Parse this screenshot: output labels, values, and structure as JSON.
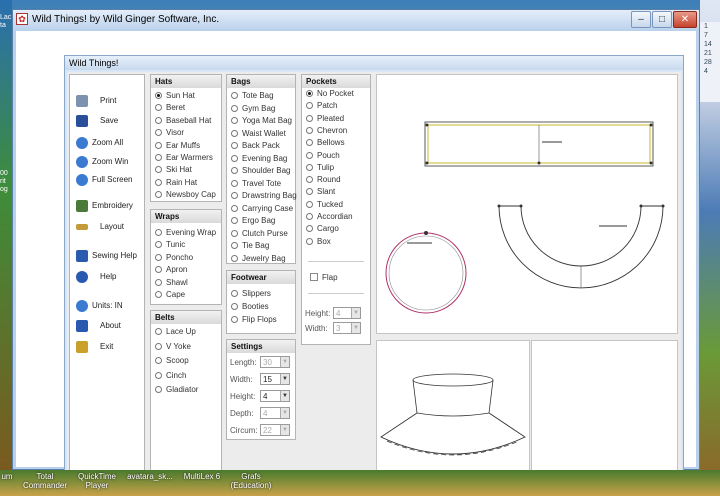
{
  "window": {
    "title": "Wild Things! by Wild Ginger Software, Inc.",
    "min": "–",
    "max": "□",
    "close": "✕"
  },
  "child": {
    "title": "Wild Things!"
  },
  "tools": [
    {
      "label": "Print",
      "icon": "printer-icon",
      "color": "#6a86a8"
    },
    {
      "label": "Save",
      "icon": "floppy-disk-icon",
      "color": "#2a4f9a"
    },
    {
      "label": "Zoom All",
      "icon": "zoom-all-icon",
      "color": "#3a7ad0"
    },
    {
      "label": "Zoom Win",
      "icon": "zoom-window-icon",
      "color": "#3a7ad0"
    },
    {
      "label": "Full Screen",
      "icon": "magnifier-icon",
      "color": "#3a7ad0"
    },
    {
      "label": "Embroidery",
      "icon": "embroidery-icon",
      "color": "#3a6a30"
    },
    {
      "label": "Layout",
      "icon": "ruler-icon",
      "color": "#b88a2a"
    },
    {
      "label": "Sewing Help",
      "icon": "sewing-help-icon",
      "color": "#2a5ab0"
    },
    {
      "label": "Help",
      "icon": "help-icon",
      "color": "#2a5ab0"
    },
    {
      "label": "Units:  IN",
      "icon": "units-icon",
      "color": "#3a7ad0"
    },
    {
      "label": "About",
      "icon": "about-icon",
      "color": "#2a5ab0"
    },
    {
      "label": "Exit",
      "icon": "exit-door-icon",
      "color": "#c8a02a"
    }
  ],
  "hats": {
    "title": "Hats",
    "options": [
      "Sun Hat",
      "Beret",
      "Baseball Hat",
      "Visor",
      "Ear Muffs",
      "Ear Warmers",
      "Ski Hat",
      "Rain Hat",
      "Newsboy Cap"
    ],
    "selected": 0
  },
  "wraps": {
    "title": "Wraps",
    "options": [
      "Evening Wrap",
      "Tunic",
      "Poncho",
      "Apron",
      "Shawl",
      "Cape"
    ]
  },
  "belts": {
    "title": "Belts",
    "options": [
      "Lace Up",
      "V Yoke",
      "Scoop",
      "Cinch",
      "Gladiator"
    ]
  },
  "bags": {
    "title": "Bags",
    "options": [
      "Tote Bag",
      "Gym Bag",
      "Yoga Mat Bag",
      "Waist Wallet",
      "Back Pack",
      "Evening Bag",
      "Shoulder Bag",
      "Travel Tote",
      "Drawstring Bag",
      "Carrying Case",
      "Ergo Bag",
      "Clutch Purse",
      "Tie Bag",
      "Jewelry Bag"
    ]
  },
  "footwear": {
    "title": "Footwear",
    "options": [
      "Slippers",
      "Booties",
      "Flip Flops"
    ]
  },
  "settings": {
    "title": "Settings",
    "fields": [
      {
        "label": "Length:",
        "value": "30",
        "disabled": true
      },
      {
        "label": "Width:",
        "value": "15",
        "disabled": false
      },
      {
        "label": "Height:",
        "value": "4",
        "disabled": false
      },
      {
        "label": "Depth:",
        "value": "4",
        "disabled": true
      },
      {
        "label": "Circum:",
        "value": "22",
        "disabled": true
      }
    ]
  },
  "pockets": {
    "title": "Pockets",
    "options": [
      "No Pocket",
      "Patch",
      "Pleated",
      "Chevron",
      "Bellows",
      "Pouch",
      "Tulip",
      "Round",
      "Slant",
      "Tucked",
      "Accordian",
      "Cargo",
      "Box"
    ],
    "selected": 0,
    "flap_label": "Flap",
    "height_label": "Height:",
    "height_value": "4",
    "width_label": "Width:",
    "width_value": "3"
  },
  "taskbar": [
    {
      "line1": "um",
      "line2": ""
    },
    {
      "line1": "Total",
      "line2": "Commander"
    },
    {
      "line1": "QuickTime",
      "line2": "Player"
    },
    {
      "line1": "avatara_sk...",
      "line2": ""
    },
    {
      "line1": "MultiLex 6",
      "line2": ""
    },
    {
      "line1": "Grafs",
      "line2": "(Education)"
    }
  ],
  "desktop_left": [
    "Lac",
    "ta",
    "00",
    "rit",
    "og"
  ],
  "calendar": [
    "1",
    "7",
    "14",
    "21",
    "28",
    "4"
  ]
}
